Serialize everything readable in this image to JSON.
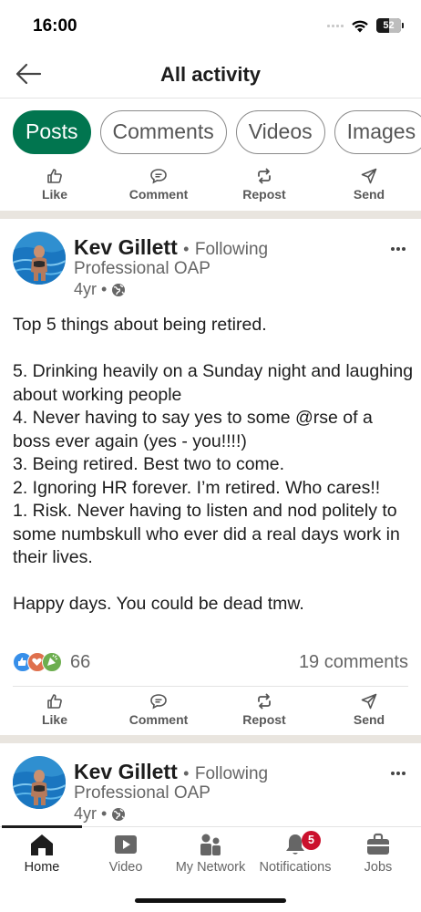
{
  "status_bar": {
    "time": "16:00",
    "battery": "52",
    "battery_level_pct": 52
  },
  "header": {
    "title": "All activity",
    "back_icon": "arrow-left-icon"
  },
  "filters": [
    {
      "label": "Posts",
      "active": true
    },
    {
      "label": "Comments",
      "active": false
    },
    {
      "label": "Videos",
      "active": false
    },
    {
      "label": "Images",
      "active": false
    }
  ],
  "actions": {
    "like": "Like",
    "comment": "Comment",
    "repost": "Repost",
    "send": "Send"
  },
  "posts": [
    {
      "author": "Kev Gillett",
      "follow_dot": "•",
      "follow_status": "Following",
      "headline": "Professional OAP",
      "age": "4yr •",
      "body": [
        "Top 5 things about being retired.",
        "",
        "5. Drinking heavily on a Sunday night and laughing about working people",
        "4. Never having to say yes to some @rse of a boss ever again (yes - you!!!!)",
        "3. Being retired. Best two to come.",
        "2. Ignoring HR forever. I’m retired. Who cares!!",
        "1. Risk. Never having to listen and nod politely to some numbskull who ever did a real days work in their lives.",
        "",
        "Happy days. You could be dead tmw."
      ],
      "reactions_count": "66",
      "comments_count": "19 comments"
    },
    {
      "author": "Kev Gillett",
      "follow_dot": "•",
      "follow_status": "Following",
      "headline": "Professional OAP",
      "age": "4yr •"
    }
  ],
  "bottom_nav": [
    {
      "label": "Home",
      "icon": "home-icon",
      "active": true
    },
    {
      "label": "Video",
      "icon": "video-icon",
      "active": false
    },
    {
      "label": "My Network",
      "icon": "network-icon",
      "active": false
    },
    {
      "label": "Notifications",
      "icon": "bell-icon",
      "active": false,
      "badge": "5"
    },
    {
      "label": "Jobs",
      "icon": "briefcase-icon",
      "active": false
    }
  ],
  "colors": {
    "accent": "#01754f",
    "badge": "#cb112d",
    "separator": "#e9e5df"
  }
}
